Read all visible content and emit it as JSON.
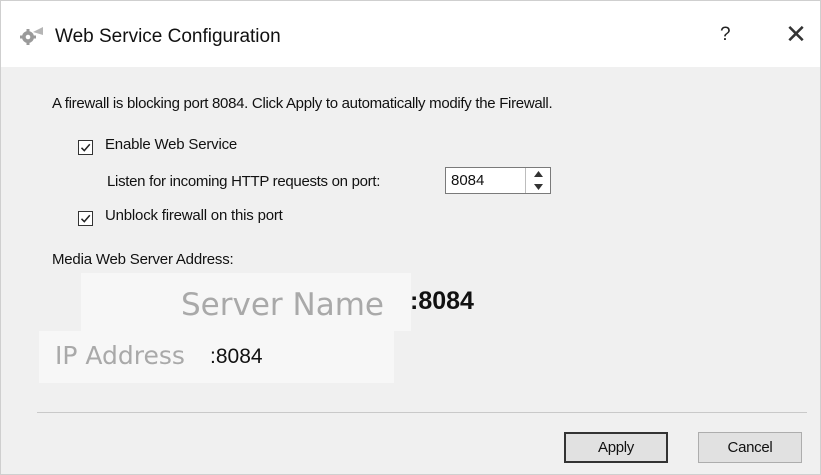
{
  "window": {
    "title": "Web Service Configuration",
    "help_label": "?",
    "close_label": "✕"
  },
  "message": "A firewall is blocking port 8084.  Click Apply to automatically modify the Firewall.",
  "enable_web_service": {
    "label": "Enable Web Service",
    "checked": true
  },
  "port": {
    "label": "Listen for incoming HTTP requests on port:",
    "value": "8084"
  },
  "unblock_firewall": {
    "label": "Unblock firewall on this port",
    "checked": true
  },
  "address": {
    "label": "Media Web Server Address:",
    "server_name": "Server Name",
    "server_port": ":8084",
    "ip_address": "IP Address",
    "ip_port": ":8084"
  },
  "buttons": {
    "apply": "Apply",
    "cancel": "Cancel"
  }
}
